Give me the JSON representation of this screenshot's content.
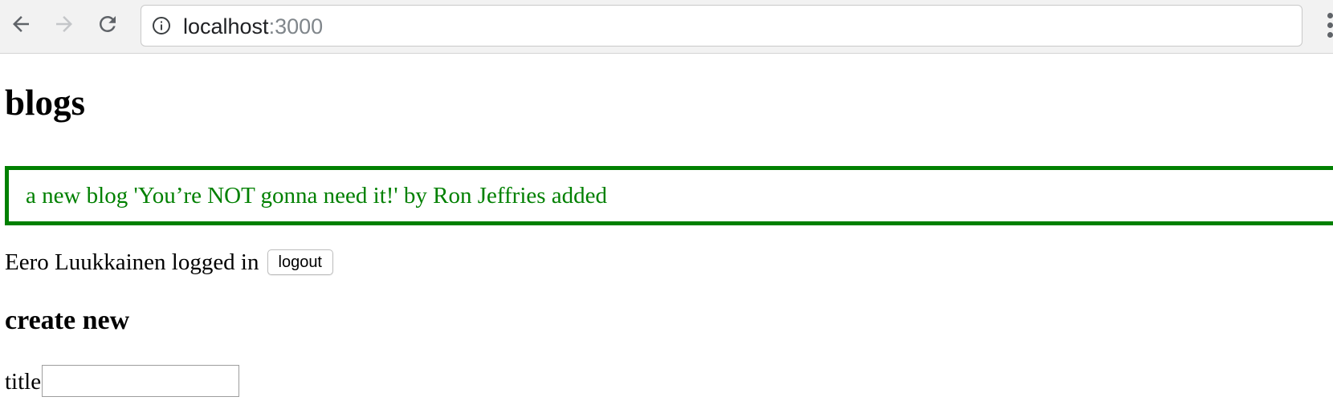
{
  "browser": {
    "url_host": "localhost",
    "url_port": ":3000",
    "icons": {
      "back": "arrow-left-icon",
      "forward": "arrow-right-icon",
      "reload": "reload-icon",
      "site_info": "info-icon",
      "menu": "vertical-dots-icon"
    }
  },
  "page": {
    "heading": "blogs",
    "notification": {
      "message": "a new blog 'You’re NOT gonna need it!' by Ron Jeffries added",
      "color": "#008000"
    },
    "user": {
      "logged_in_text": "Eero Luukkainen logged in",
      "logout_label": "logout"
    },
    "create_form": {
      "heading": "create new",
      "title_label": "title",
      "title_value": ""
    }
  }
}
